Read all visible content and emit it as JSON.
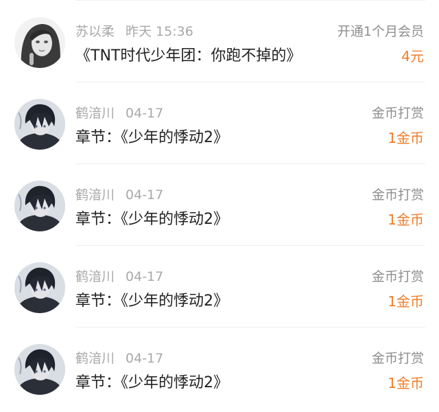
{
  "records": [
    {
      "name": "苏以柔",
      "time": "昨天 15:36",
      "title": "《TNT时代少年团：你跑不掉的》",
      "type": "开通1个月会员",
      "amount": "4元",
      "avatar": "grayscale-girl-avatar"
    },
    {
      "name": "鹤湆川",
      "time": "04-17",
      "title": "章节：《少年的悸动2》",
      "type": "金币打赏",
      "amount": "1金币",
      "avatar": "anime-boy-avatar"
    },
    {
      "name": "鹤湆川",
      "time": "04-17",
      "title": "章节：《少年的悸动2》",
      "type": "金币打赏",
      "amount": "1金币",
      "avatar": "anime-boy-avatar"
    },
    {
      "name": "鹤湆川",
      "time": "04-17",
      "title": "章节：《少年的悸动2》",
      "type": "金币打赏",
      "amount": "1金币",
      "avatar": "anime-boy-avatar"
    },
    {
      "name": "鹤湆川",
      "time": "04-17",
      "title": "章节：《少年的悸动2》",
      "type": "金币打赏",
      "amount": "1金币",
      "avatar": "anime-boy-avatar"
    }
  ],
  "colors": {
    "amount": "#f07d2a",
    "secondary_text": "#a8a8a8",
    "primary_text": "#222222"
  }
}
